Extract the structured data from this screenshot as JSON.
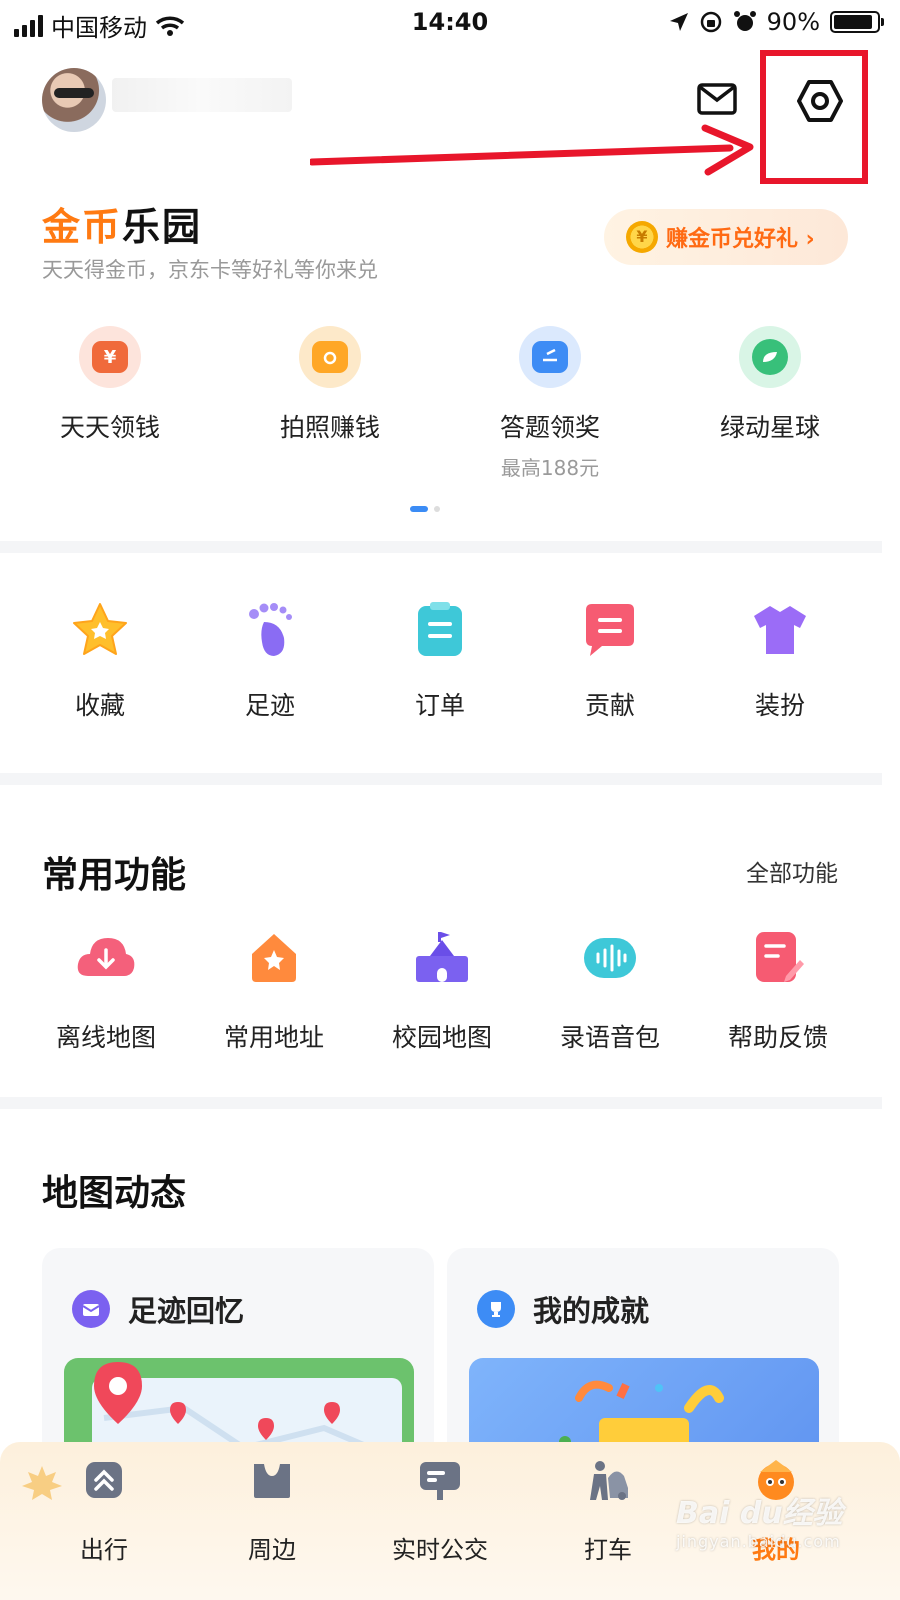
{
  "status_bar": {
    "carrier": "中国移动",
    "time": "14:40",
    "battery": "90%",
    "battery_level": 0.9
  },
  "header": {
    "mail_icon": "mail-icon",
    "settings_icon": "gear-icon"
  },
  "annotation": {
    "highlight_color": "#e8162b"
  },
  "coin_park": {
    "title_part1": "金币",
    "title_part2": "乐园",
    "subtitle": "天天得金币，京东卡等好礼等你来兑",
    "button_label": "赚金币兑好礼 ›",
    "coin_symbol": "¥",
    "items": [
      {
        "label": "天天领钱",
        "sub": ""
      },
      {
        "label": "拍照赚钱",
        "sub": ""
      },
      {
        "label": "答题领奖",
        "sub": "最高188元"
      },
      {
        "label": "绿动星球",
        "sub": ""
      }
    ]
  },
  "quick": {
    "items": [
      {
        "label": "收藏"
      },
      {
        "label": "足迹"
      },
      {
        "label": "订单"
      },
      {
        "label": "贡献"
      },
      {
        "label": "装扮"
      }
    ]
  },
  "common": {
    "title": "常用功能",
    "all_label": "全部功能",
    "items": [
      {
        "label": "离线地图"
      },
      {
        "label": "常用地址"
      },
      {
        "label": "校园地图"
      },
      {
        "label": "录语音包"
      },
      {
        "label": "帮助反馈"
      }
    ]
  },
  "map_feed": {
    "title": "地图动态",
    "cards": [
      {
        "title": "足迹回忆"
      },
      {
        "title": "我的成就"
      }
    ]
  },
  "tabbar": {
    "tabs": [
      {
        "label": "出行"
      },
      {
        "label": "周边"
      },
      {
        "label": "实时公交"
      },
      {
        "label": "打车"
      },
      {
        "label": "我的"
      }
    ]
  },
  "watermark": {
    "line1": "Bai du经验",
    "line2": "jingyan.baidu.com"
  }
}
